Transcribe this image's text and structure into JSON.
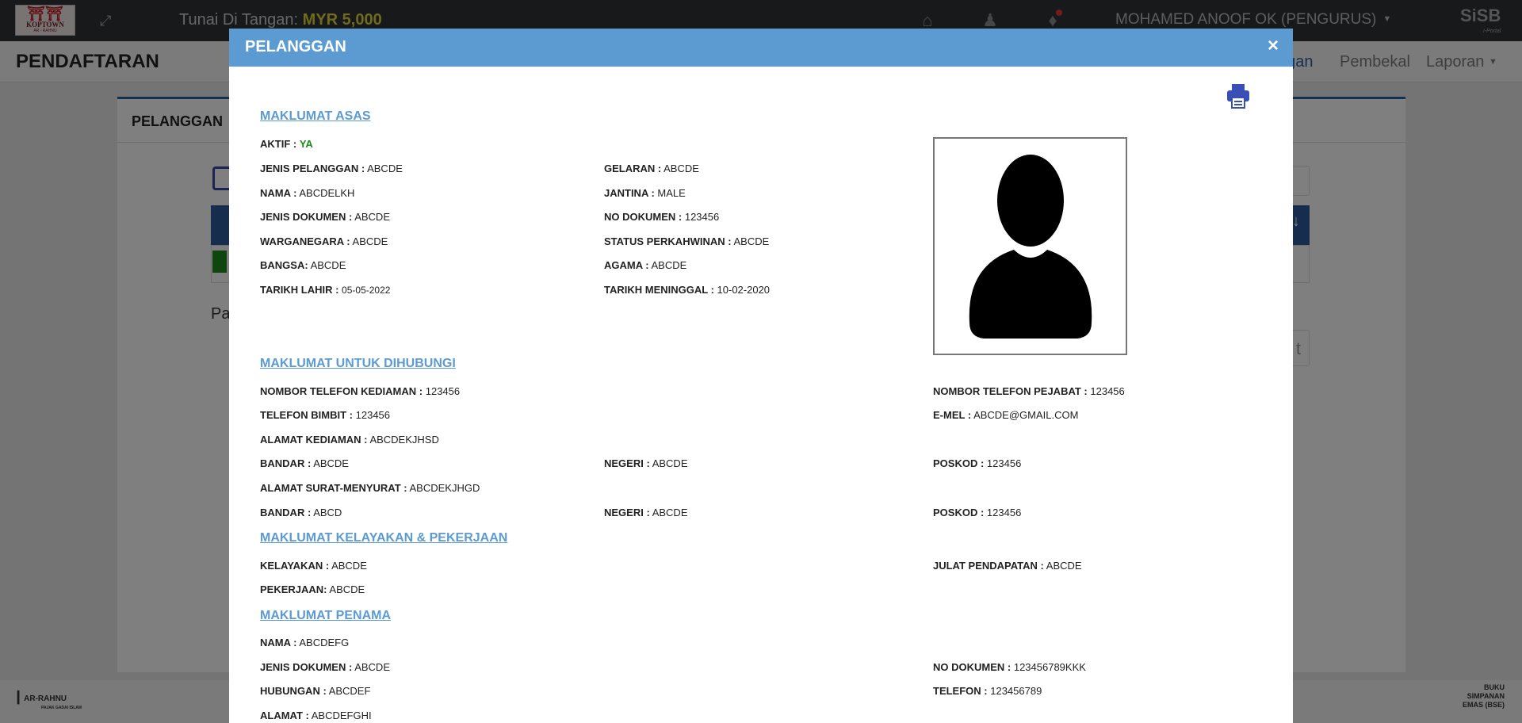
{
  "header": {
    "logo_text": "KOPTOWN",
    "logo_sub": "AR - RAHNU",
    "cash_label": "Tunai Di Tangan:",
    "cash_value": "MYR 5,000",
    "user": "MOHAMED ANOOF OK (PENGURUS)",
    "brand": "SiSB",
    "brand_sub": "i-Portal",
    "icons": [
      "home-icon",
      "user-pin-icon",
      "bell-icon",
      "expand-icon",
      "caret-down-icon"
    ]
  },
  "subheader": {
    "title": "PENDAFTARAN",
    "nav": [
      "ggan",
      "Pembekal",
      "Laporan"
    ]
  },
  "background": {
    "card_title": "PELANGGAN",
    "pa_text": "Pa",
    "btn_text": "t"
  },
  "footer": {
    "left_text": "AR-RAHNU",
    "left_sub": "PAJAK GADAI ISLAM",
    "right_line1": "BUKU",
    "right_line2": "SIMPANAN",
    "right_line3": "EMAS (BSE)"
  },
  "modal": {
    "title": "PELANGGAN",
    "close": "×",
    "sections": {
      "asas": "MAKLUMAT ASAS",
      "hubungi": "MAKLUMAT UNTUK DIHUBUNGI",
      "kelayakan": "MAKLUMAT KELAYAKAN & PEKERJAAN",
      "penama": "MAKLUMAT PENAMA"
    },
    "fields": {
      "aktif": {
        "label": "AKTIF :",
        "value": "YA"
      },
      "jenis_pelanggan": {
        "label": "JENIS PELANGGAN :",
        "value": "ABCDE"
      },
      "gelaran": {
        "label": "GELARAN :",
        "value": "ABCDE"
      },
      "nama": {
        "label": "NAMA :",
        "value": "ABCDELKH"
      },
      "jantina": {
        "label": "JANTINA :",
        "value": "MALE"
      },
      "jenis_dokumen": {
        "label": "JENIS DOKUMEN :",
        "value": "ABCDE"
      },
      "no_dokumen": {
        "label": "NO DOKUMEN :",
        "value": "123456"
      },
      "warganegara": {
        "label": "WARGANEGARA :",
        "value": "ABCDE"
      },
      "status_perkahwinan": {
        "label": "STATUS PERKAHWINAN :",
        "value": "ABCDE"
      },
      "bangsa": {
        "label": "BANGSA:",
        "value": "ABCDE"
      },
      "agama": {
        "label": "AGAMA :",
        "value": "ABCDE"
      },
      "tarikh_lahir": {
        "label": "TARIKH LAHIR :",
        "value": "05-05-2022"
      },
      "tarikh_meninggal": {
        "label": "TARIKH MENINGGAL :",
        "value": "10-02-2020"
      },
      "tel_kediaman": {
        "label": "NOMBOR TELEFON KEDIAMAN :",
        "value": "123456"
      },
      "tel_pejabat": {
        "label": "NOMBOR TELEFON PEJABAT :",
        "value": "123456"
      },
      "tel_bimbit": {
        "label": "TELEFON BIMBIT :",
        "value": "123456"
      },
      "emel": {
        "label": "E-MEL :",
        "value": "ABCDE@GMAIL.COM"
      },
      "alamat_kediaman": {
        "label": "ALAMAT KEDIAMAN :",
        "value": "ABCDEKJHSD"
      },
      "bandar_1": {
        "label": "BANDAR :",
        "value": "ABCDE"
      },
      "negeri_1": {
        "label": "NEGERI :",
        "value": "ABCDE"
      },
      "poskod_1": {
        "label": "POSKOD :",
        "value": "123456"
      },
      "alamat_surat": {
        "label": "ALAMAT SURAT-MENYURAT :",
        "value": "ABCDEKJHGD"
      },
      "bandar_2": {
        "label": "BANDAR :",
        "value": "ABCD"
      },
      "negeri_2": {
        "label": "NEGERI :",
        "value": "ABCDE"
      },
      "poskod_2": {
        "label": "POSKOD :",
        "value": "123456"
      },
      "kelayakan": {
        "label": "KELAYAKAN :",
        "value": "ABCDE"
      },
      "julat_pendapatan": {
        "label": "JULAT PENDAPATAN :",
        "value": "ABCDE"
      },
      "pekerjaan": {
        "label": "PEKERJAAN:",
        "value": "ABCDE"
      },
      "penama_nama": {
        "label": "NAMA :",
        "value": "ABCDEFG"
      },
      "penama_jenis_dokumen": {
        "label": "JENIS DOKUMEN :",
        "value": "ABCDE"
      },
      "penama_no_dokumen": {
        "label": "NO DOKUMEN :",
        "value": "123456789KKK"
      },
      "penama_hubungan": {
        "label": "HUBUNGAN :",
        "value": "ABCDEF"
      },
      "penama_telefon": {
        "label": "TELEFON :",
        "value": "123456789"
      },
      "penama_alamat": {
        "label": "ALAMAT :",
        "value": "ABCDEFGHI"
      }
    }
  }
}
